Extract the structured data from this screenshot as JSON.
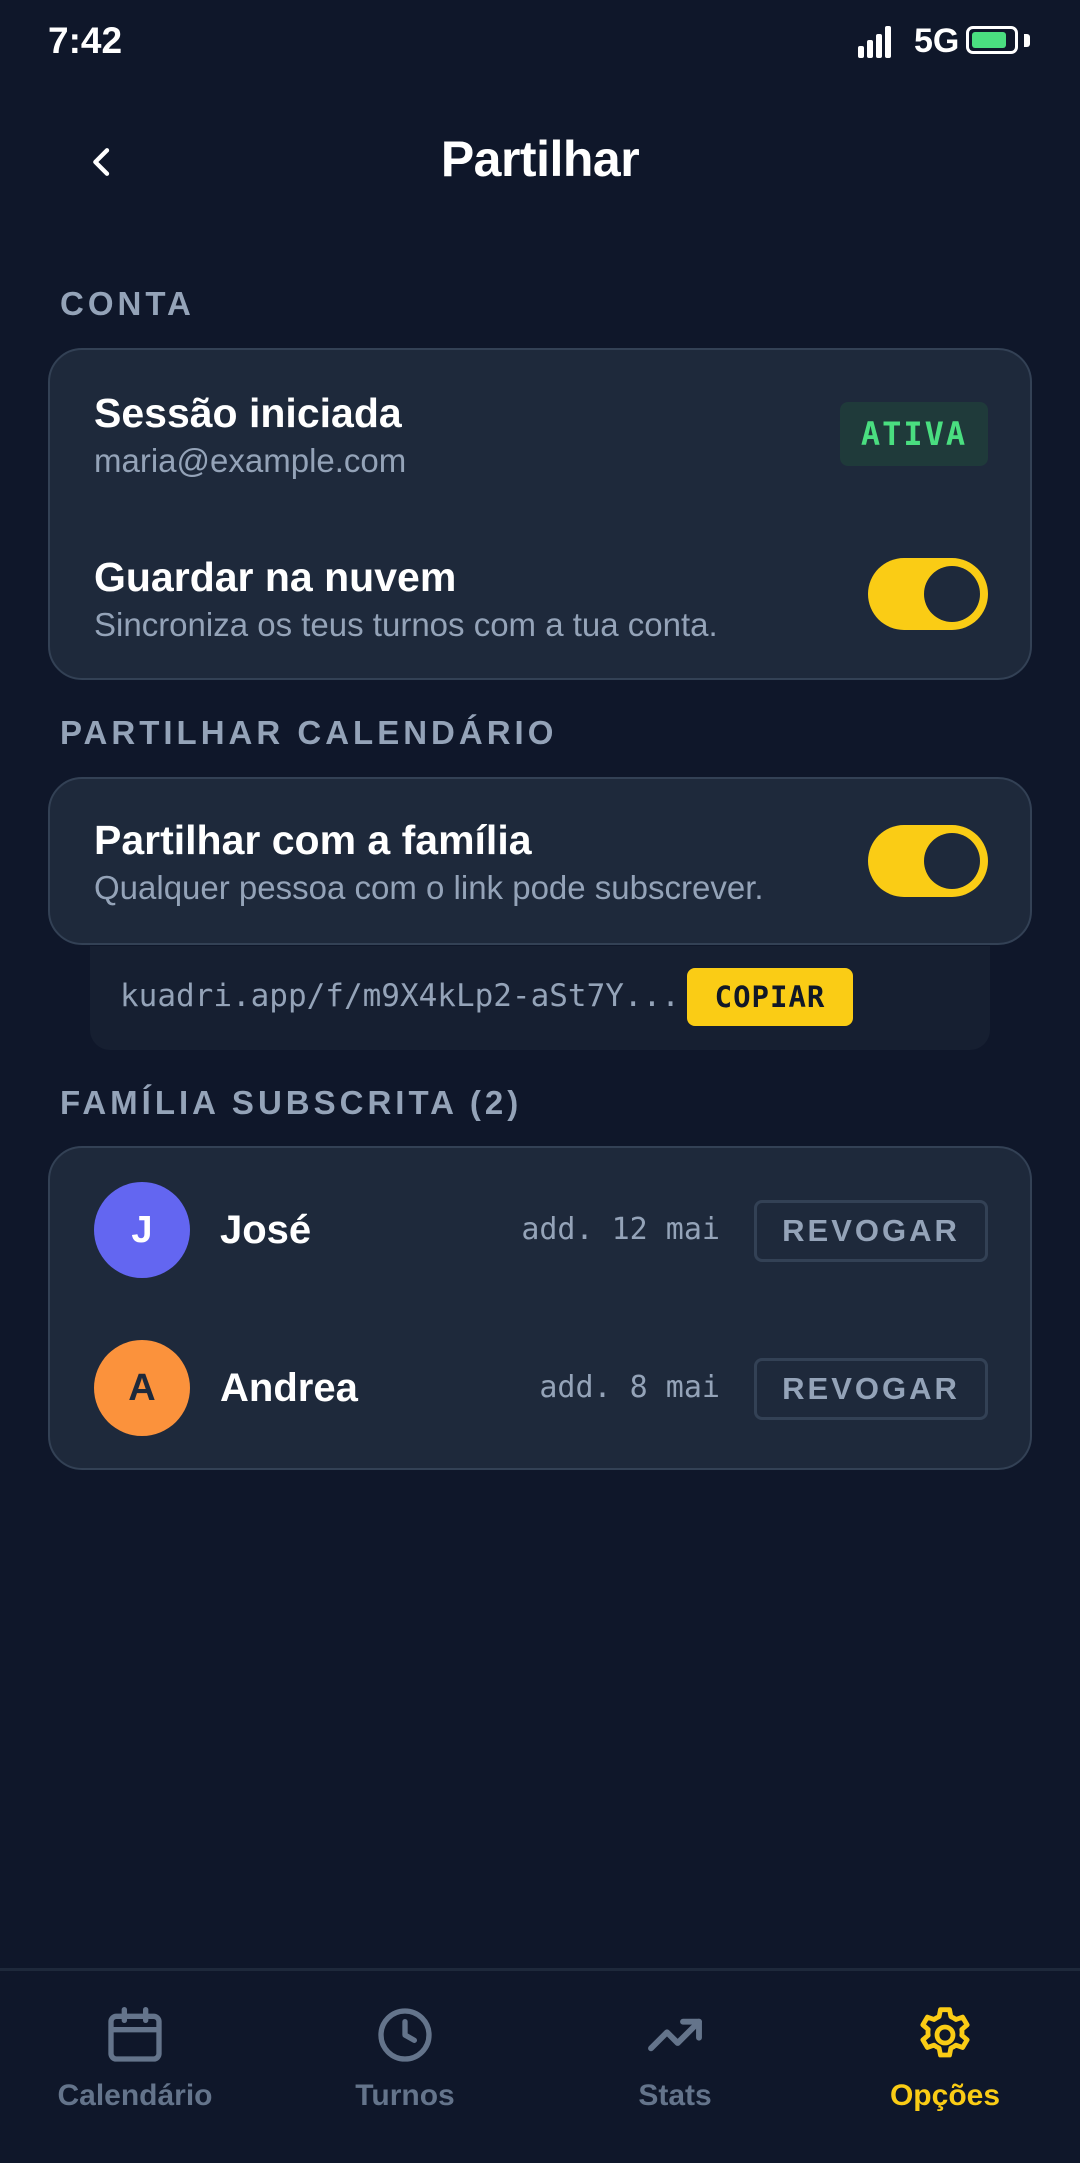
{
  "status_bar": {
    "time": "7:42",
    "network": "5G",
    "battery_level": 0.85
  },
  "header": {
    "title": "Partilhar",
    "back_icon": "chevron-left-icon"
  },
  "account": {
    "section_label": "CONTA",
    "session": {
      "title": "Sessão iniciada",
      "email": "maria@example.com",
      "badge": "ATIVA"
    },
    "cloud": {
      "title": "Guardar na nuvem",
      "subtitle": "Sincroniza os teus turnos com a tua conta.",
      "enabled": true
    }
  },
  "share": {
    "section_label": "PARTILHAR CALENDÁRIO",
    "family": {
      "title": "Partilhar com a família",
      "subtitle": "Qualquer pessoa com o link pode subscrever.",
      "enabled": true
    },
    "link": "kuadri.app/f/m9X4kLp2-aSt7Y...",
    "copy_label": "COPIAR"
  },
  "subscribers": {
    "section_label": "FAMÍLIA SUBSCRITA (2)",
    "members": [
      {
        "initial": "J",
        "name": "José",
        "added": "add. 12 mai",
        "revoke_label": "REVOGAR",
        "avatar_color": "#6366f1",
        "initial_color": "#ffffff"
      },
      {
        "initial": "A",
        "name": "Andrea",
        "added": "add. 8 mai",
        "revoke_label": "REVOGAR",
        "avatar_color": "#fb923c",
        "initial_color": "#1e293b"
      }
    ]
  },
  "nav": {
    "items": [
      {
        "label": "Calendário",
        "icon": "calendar-icon",
        "active": false
      },
      {
        "label": "Turnos",
        "icon": "clock-icon",
        "active": false
      },
      {
        "label": "Stats",
        "icon": "trending-up-icon",
        "active": false
      },
      {
        "label": "Opções",
        "icon": "gear-icon",
        "active": true
      }
    ]
  },
  "colors": {
    "background": "#0f172a",
    "card": "#1e293b",
    "accent": "#facc15",
    "success": "#4ade80",
    "muted": "#94a3b8"
  }
}
